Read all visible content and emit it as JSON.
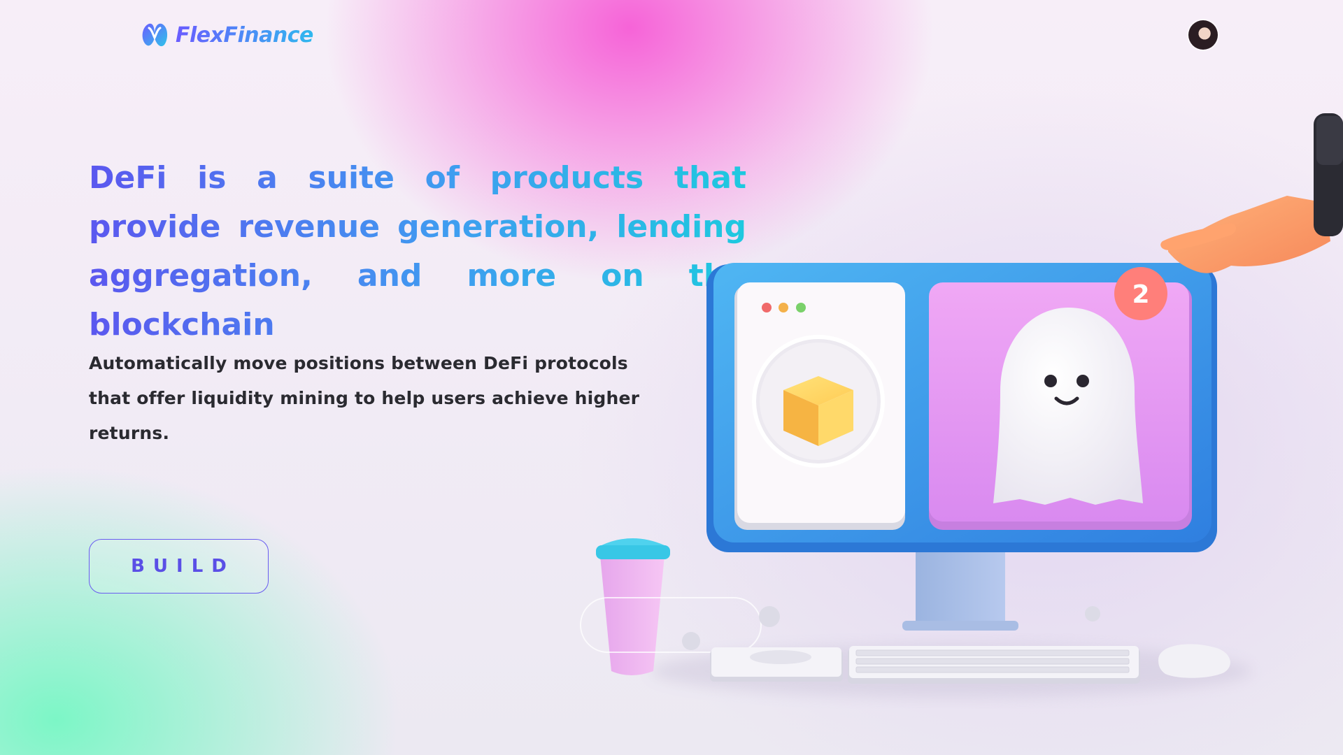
{
  "header": {
    "logo_text": "FlexFinance",
    "logo_icon": "flex-finance-logo-icon",
    "avatar_icon": "user-avatar"
  },
  "hero": {
    "headline": "DeFi is a suite of products that provide revenue generation, lending aggregation, and more on the blockchain",
    "subtext": "Automatically move positions between DeFi protocols that offer liquidity mining to help users achieve higher returns.",
    "cta_label": "BUILD"
  },
  "illustration": {
    "notification_count": "2",
    "window_dots": [
      "#f06a6a",
      "#f4b14a",
      "#7ad16a"
    ],
    "accent_blue": "#3d97ec",
    "panel_pink": "#e59af0"
  },
  "colors": {
    "headline_start": "#5b57ef",
    "headline_end": "#1ec9df",
    "button_border": "#6a5cf0",
    "body_text": "#2a2a30"
  }
}
